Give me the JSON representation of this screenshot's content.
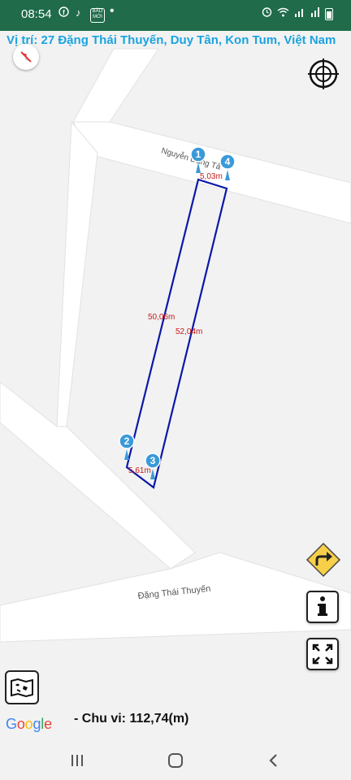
{
  "status_bar": {
    "time": "08:54",
    "badge_text": "BÁO MỚI",
    "icons": [
      "facebook-icon",
      "tiktok-icon",
      "baomoi-icon",
      "alarm-icon",
      "wifi-icon",
      "signal-icon",
      "battery-icon"
    ]
  },
  "location": {
    "text": "Vị trí: 27 Đặng Thái Thuyến, Duy Tân, Kon Tum, Việt Nam"
  },
  "map": {
    "road_top_label": "Nguyễn Đăng Tả",
    "road_bottom_label": "Đặng Thái Thuyến",
    "polygon_color": "#0a18a8",
    "marker_color": "#3a9ad9",
    "markers": [
      "1",
      "2",
      "3",
      "4"
    ],
    "edge_labels": [
      "5,03m",
      "50,06m",
      "52,04m",
      "5,61m"
    ]
  },
  "controls": {
    "compass": "compass-icon",
    "my_location": "crosshair-icon",
    "route": "route-arrow-icon",
    "info": "info-icon",
    "fullscreen": "expand-icon",
    "map_type": "map-layers-icon"
  },
  "footer": {
    "logo": "Google",
    "perimeter": "- Chu vi: 112,74(m)"
  },
  "nav_bar": {
    "buttons": [
      "recent-apps-icon",
      "home-icon",
      "back-icon"
    ]
  }
}
